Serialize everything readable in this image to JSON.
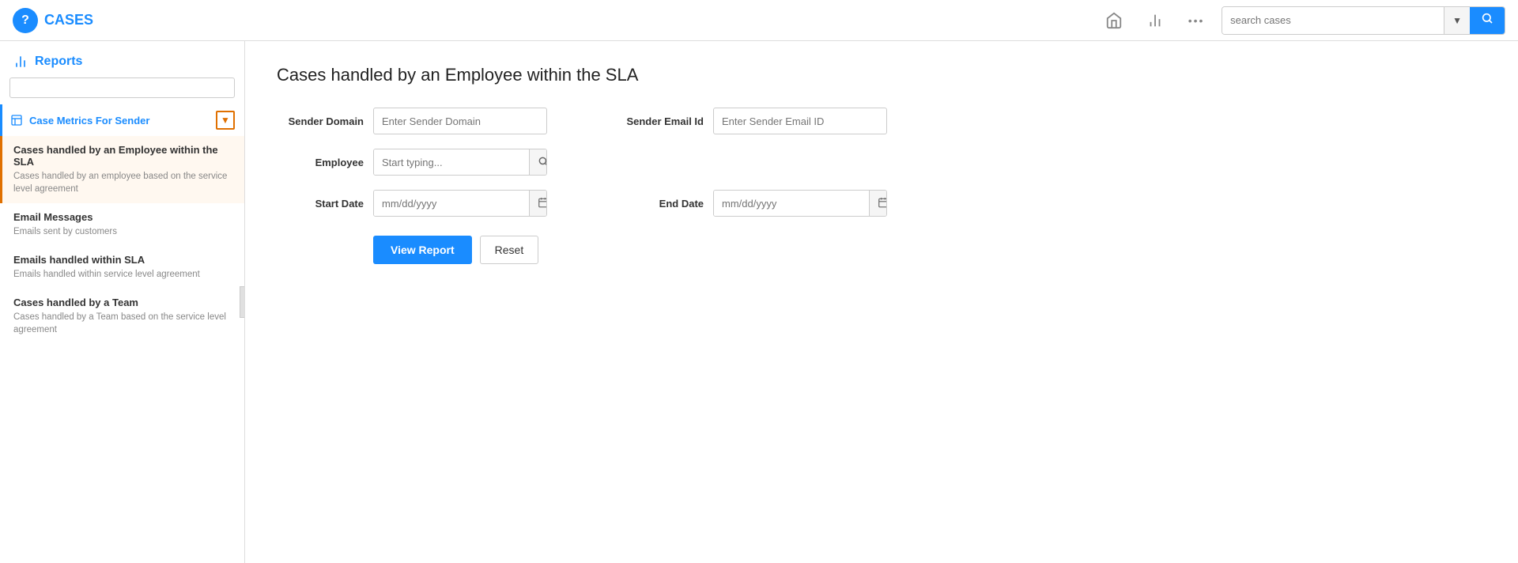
{
  "app": {
    "title": "CASES",
    "logo_letter": "?"
  },
  "nav": {
    "home_icon": "⌂",
    "chart_icon": "📊",
    "more_icon": "•••",
    "search_placeholder": "search cases",
    "search_dropdown_icon": "▼",
    "search_submit_icon": "🔍"
  },
  "sidebar": {
    "header": "Reports",
    "bar_icon": "📊",
    "active_item_label": "Case Metrics For Sender",
    "active_item_icon": "📋",
    "items": [
      {
        "title": "Cases handled by an Employee within the SLA",
        "description": "Cases handled by an employee based on the service level agreement",
        "selected": true
      },
      {
        "title": "Email Messages",
        "description": "Emails sent by customers",
        "selected": false
      },
      {
        "title": "Emails handled within SLA",
        "description": "Emails handled within service level agreement",
        "selected": false
      },
      {
        "title": "Cases handled by a Team",
        "description": "Cases handled by a Team based on the service level agreement",
        "selected": false
      }
    ],
    "collapse_icon": "‹"
  },
  "main": {
    "title": "Cases handled by an Employee within the SLA",
    "form": {
      "sender_domain_label": "Sender Domain",
      "sender_domain_placeholder": "Enter Sender Domain",
      "sender_email_label": "Sender Email Id",
      "sender_email_placeholder": "Enter Sender Email ID",
      "employee_label": "Employee",
      "employee_placeholder": "Start typing...",
      "start_date_label": "Start Date",
      "start_date_placeholder": "mm/dd/yyyy",
      "end_date_label": "End Date",
      "end_date_placeholder": "mm/dd/yyyy"
    },
    "buttons": {
      "view_report": "View Report",
      "reset": "Reset"
    }
  }
}
